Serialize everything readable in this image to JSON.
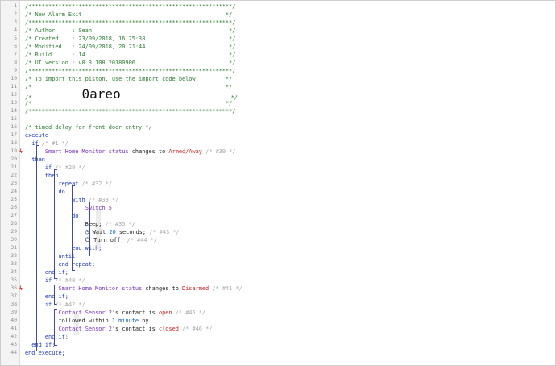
{
  "editor": {
    "lines": [
      {
        "n": "1",
        "marker": "",
        "tokens": [
          {
            "t": "/*************************************************************/",
            "c": "c-cmt"
          }
        ]
      },
      {
        "n": "2",
        "marker": "",
        "tokens": [
          {
            "t": "/* New Alarm Exit                                           */",
            "c": "c-cmt"
          }
        ]
      },
      {
        "n": "3",
        "marker": "",
        "tokens": [
          {
            "t": "/*************************************************************/",
            "c": "c-cmt"
          }
        ]
      },
      {
        "n": "4",
        "marker": "",
        "tokens": [
          {
            "t": "/* Author     : Sean                                         */",
            "c": "c-cmt"
          }
        ]
      },
      {
        "n": "5",
        "marker": "",
        "tokens": [
          {
            "t": "/* Created    : 23/09/2018, 16:25:38                         */",
            "c": "c-cmt"
          }
        ]
      },
      {
        "n": "6",
        "marker": "",
        "tokens": [
          {
            "t": "/* Modified   : 24/09/2018, 20:21:44                         */",
            "c": "c-cmt"
          }
        ]
      },
      {
        "n": "7",
        "marker": "",
        "tokens": [
          {
            "t": "/* Build      : 14                                           */",
            "c": "c-cmt"
          }
        ]
      },
      {
        "n": "8",
        "marker": "",
        "tokens": [
          {
            "t": "/* UI version : v0.3.108.20180906                            */",
            "c": "c-cmt"
          }
        ]
      },
      {
        "n": "9",
        "marker": "",
        "tokens": [
          {
            "t": "/*************************************************************/",
            "c": "c-cmt"
          }
        ]
      },
      {
        "n": "10",
        "marker": "",
        "tokens": [
          {
            "t": "/* To import this piston, use the import code below:        */",
            "c": "c-cmt"
          }
        ]
      },
      {
        "n": "11",
        "marker": "",
        "tokens": [
          {
            "t": "/*                                                          */",
            "c": "c-cmt"
          }
        ]
      },
      {
        "n": "12",
        "marker": "",
        "tokens": [
          {
            "t": "/*               ",
            "c": "c-cmt"
          },
          {
            "t": "0areo",
            "c": "c-big"
          },
          {
            "t": "                                 */",
            "c": "c-cmt"
          }
        ]
      },
      {
        "n": "13",
        "marker": "",
        "tokens": [
          {
            "t": "/*                                                          */",
            "c": "c-cmt"
          }
        ]
      },
      {
        "n": "14",
        "marker": "",
        "tokens": [
          {
            "t": "/*************************************************************/",
            "c": "c-cmt"
          }
        ]
      },
      {
        "n": "15",
        "marker": "",
        "tokens": []
      },
      {
        "n": "16",
        "marker": "",
        "tokens": [
          {
            "t": "/* timed delay for front door entry */",
            "c": "c-cmt"
          }
        ]
      },
      {
        "n": "17",
        "marker": "",
        "tokens": [
          {
            "t": "execute",
            "c": "c-kw"
          }
        ]
      },
      {
        "n": "18",
        "marker": "",
        "tokens": [
          {
            "t": "  if ",
            "c": "c-kw"
          },
          {
            "t": "/* #1 */",
            "c": "c-grey"
          }
        ]
      },
      {
        "n": "19",
        "marker": "ϟ",
        "tokens": [
          {
            "t": "      ",
            "c": ""
          },
          {
            "t": "Smart Home Monitor status",
            "c": "c-dev"
          },
          {
            "t": " changes to ",
            "c": ""
          },
          {
            "t": "Armed/Away",
            "c": "c-val"
          },
          {
            "t": " /* #39 */",
            "c": "c-grey"
          }
        ]
      },
      {
        "n": "20",
        "marker": "",
        "tokens": [
          {
            "t": "  then",
            "c": "c-kw"
          }
        ]
      },
      {
        "n": "21",
        "marker": "",
        "tokens": [
          {
            "t": "      if ",
            "c": "c-kw"
          },
          {
            "t": "/* #29 */",
            "c": "c-grey"
          }
        ]
      },
      {
        "n": "22",
        "marker": "",
        "tokens": [
          {
            "t": "      then",
            "c": "c-kw"
          }
        ]
      },
      {
        "n": "23",
        "marker": "",
        "tokens": [
          {
            "t": "          repeat ",
            "c": "c-kw"
          },
          {
            "t": "/* #32 */",
            "c": "c-grey"
          }
        ]
      },
      {
        "n": "24",
        "marker": "",
        "tokens": [
          {
            "t": "          do",
            "c": "c-kw"
          }
        ]
      },
      {
        "n": "25",
        "marker": "",
        "tokens": [
          {
            "t": "              with ",
            "c": "c-kw"
          },
          {
            "t": "/* #33 */",
            "c": "c-grey"
          }
        ]
      },
      {
        "n": "26",
        "marker": "",
        "tokens": [
          {
            "t": "                  ",
            "c": ""
          },
          {
            "t": "Switch 5",
            "c": "c-dev"
          }
        ]
      },
      {
        "n": "27",
        "marker": "",
        "tokens": [
          {
            "t": "              do",
            "c": "c-kw"
          }
        ]
      },
      {
        "n": "28",
        "marker": "",
        "tokens": [
          {
            "t": "                  Beep; ",
            "c": ""
          },
          {
            "t": "/* #35 */",
            "c": "c-grey"
          }
        ]
      },
      {
        "n": "29",
        "marker": "",
        "tokens": [
          {
            "t": "                  ",
            "c": ""
          },
          {
            "t": "◷",
            "c": "icon-glyph"
          },
          {
            "t": " Wait ",
            "c": ""
          },
          {
            "t": "20",
            "c": "c-num"
          },
          {
            "t": " seconds; ",
            "c": ""
          },
          {
            "t": "/* #43 */",
            "c": "c-grey"
          }
        ]
      },
      {
        "n": "30",
        "marker": "",
        "tokens": [
          {
            "t": "                  ",
            "c": ""
          },
          {
            "t": "⏻",
            "c": "icon-glyph"
          },
          {
            "t": " Turn off; ",
            "c": ""
          },
          {
            "t": "/* #44 */",
            "c": "c-grey"
          }
        ]
      },
      {
        "n": "31",
        "marker": "",
        "tokens": [
          {
            "t": "              end with;",
            "c": "c-kw"
          }
        ]
      },
      {
        "n": "32",
        "marker": "",
        "tokens": [
          {
            "t": "          until",
            "c": "c-kw"
          }
        ]
      },
      {
        "n": "33",
        "marker": "",
        "tokens": [
          {
            "t": "          end repeat;",
            "c": "c-kw"
          }
        ]
      },
      {
        "n": "34",
        "marker": "",
        "tokens": [
          {
            "t": "      end if;",
            "c": "c-kw"
          }
        ]
      },
      {
        "n": "35",
        "marker": "",
        "tokens": [
          {
            "t": "      if ",
            "c": "c-kw"
          },
          {
            "t": "/* #40 */",
            "c": "c-grey"
          }
        ]
      },
      {
        "n": "36",
        "marker": "ϟ",
        "tokens": [
          {
            "t": "          ",
            "c": ""
          },
          {
            "t": "Smart Home Monitor status",
            "c": "c-dev"
          },
          {
            "t": " changes to ",
            "c": ""
          },
          {
            "t": "Disarmed",
            "c": "c-val"
          },
          {
            "t": " /* #41 */",
            "c": "c-grey"
          }
        ]
      },
      {
        "n": "37",
        "marker": "",
        "tokens": [
          {
            "t": "      end if;",
            "c": "c-kw"
          }
        ]
      },
      {
        "n": "38",
        "marker": "",
        "tokens": [
          {
            "t": "      if ",
            "c": "c-kw"
          },
          {
            "t": "/* #42 */",
            "c": "c-grey"
          }
        ]
      },
      {
        "n": "39",
        "marker": "",
        "tokens": [
          {
            "t": "          ",
            "c": ""
          },
          {
            "t": "Contact Sensor 2",
            "c": "c-dev"
          },
          {
            "t": "'s contact is ",
            "c": ""
          },
          {
            "t": "open",
            "c": "c-val"
          },
          {
            "t": " /* #45 */",
            "c": "c-grey"
          }
        ]
      },
      {
        "n": "40",
        "marker": "",
        "tokens": [
          {
            "t": "          followed within ",
            "c": ""
          },
          {
            "t": "1 minute",
            "c": "c-num"
          },
          {
            "t": " by",
            "c": ""
          }
        ]
      },
      {
        "n": "41",
        "marker": "",
        "tokens": [
          {
            "t": "          ",
            "c": ""
          },
          {
            "t": "Contact Sensor 2",
            "c": "c-dev"
          },
          {
            "t": "'s contact is ",
            "c": ""
          },
          {
            "t": "closed",
            "c": "c-val"
          },
          {
            "t": " /* #46 */",
            "c": "c-grey"
          }
        ]
      },
      {
        "n": "42",
        "marker": "",
        "tokens": [
          {
            "t": "      end if;",
            "c": "c-kw"
          }
        ]
      },
      {
        "n": "43",
        "marker": "",
        "tokens": [
          {
            "t": "  end if;",
            "c": "c-kw"
          }
        ]
      },
      {
        "n": "44",
        "marker": "",
        "tokens": [
          {
            "t": "end execute;",
            "c": "c-kw"
          }
        ]
      }
    ]
  },
  "colors": {
    "comment": "#2e7d32",
    "keyword": "#1e3ab8",
    "device": "#7a2fbf",
    "value": "#c62828",
    "number": "#1565c0",
    "statement_id": "#a8a8a8",
    "trigger_marker": "#d63b2f"
  },
  "icons": {
    "trigger_marker": "lightning-trigger-icon",
    "wait": "clock-icon",
    "turn_off": "power-icon"
  }
}
